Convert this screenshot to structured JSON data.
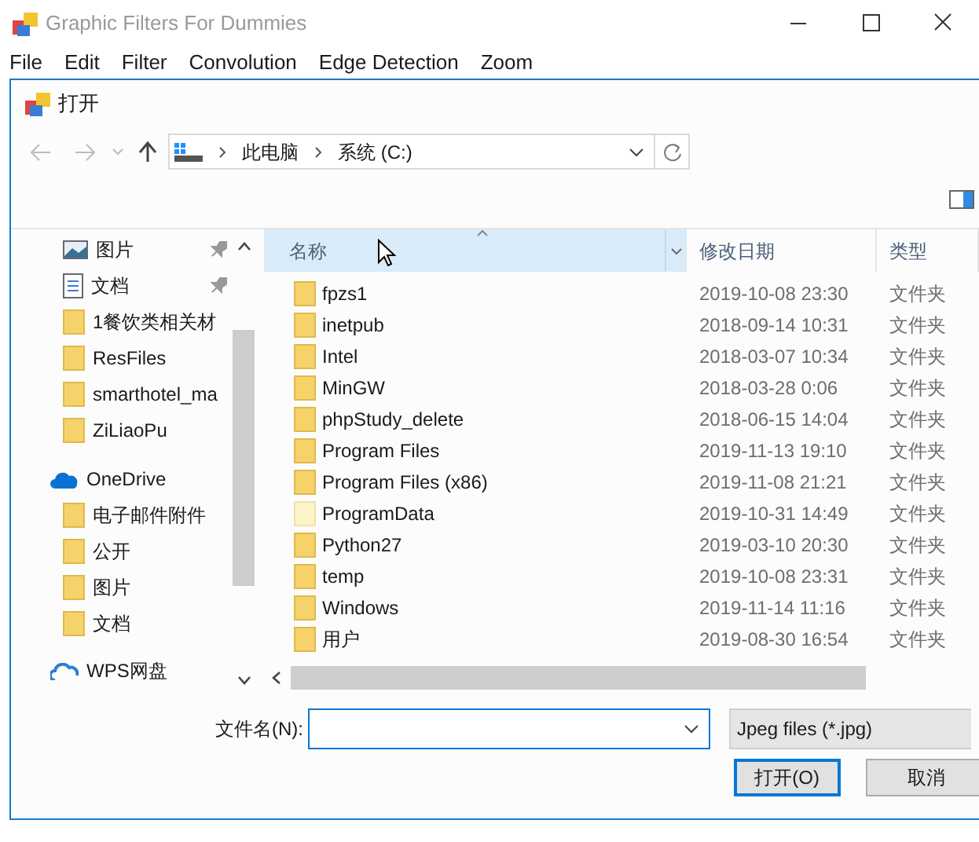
{
  "window": {
    "title": "Graphic Filters For Dummies"
  },
  "menu": [
    "File",
    "Edit",
    "Filter",
    "Convolution",
    "Edge Detection",
    "Zoom"
  ],
  "dialog": {
    "title": "打开",
    "address": {
      "segments": [
        "此电脑",
        "系统 (C:)"
      ]
    },
    "nav_pane": [
      {
        "kind": "pictures",
        "label": "图片",
        "pinned": true
      },
      {
        "kind": "document",
        "label": "文档",
        "pinned": true
      },
      {
        "kind": "folder",
        "label": "1餐饮类相关材",
        "pinned": false
      },
      {
        "kind": "folder",
        "label": "ResFiles",
        "pinned": false
      },
      {
        "kind": "folder",
        "label": "smarthotel_ma",
        "pinned": false
      },
      {
        "kind": "folder",
        "label": "ZiLiaoPu",
        "pinned": false
      },
      {
        "kind": "onedrive",
        "label": "OneDrive",
        "pinned": false
      },
      {
        "kind": "folder",
        "label": "电子邮件附件",
        "pinned": false
      },
      {
        "kind": "folder",
        "label": "公开",
        "pinned": false
      },
      {
        "kind": "folder",
        "label": "图片",
        "pinned": false
      },
      {
        "kind": "folder",
        "label": "文档",
        "pinned": false
      },
      {
        "kind": "wps",
        "label": "WPS网盘",
        "pinned": false
      }
    ],
    "columns": [
      {
        "label": "名称",
        "highlighted": true,
        "sorted": true
      },
      {
        "label": "修改日期",
        "highlighted": false,
        "sorted": false
      },
      {
        "label": "类型",
        "highlighted": false,
        "sorted": false
      }
    ],
    "rows": [
      {
        "name": "fpzs1",
        "date": "2019-10-08 23:30",
        "type": "文件夹",
        "hidden": false
      },
      {
        "name": "inetpub",
        "date": "2018-09-14 10:31",
        "type": "文件夹",
        "hidden": false
      },
      {
        "name": "Intel",
        "date": "2018-03-07 10:34",
        "type": "文件夹",
        "hidden": false
      },
      {
        "name": "MinGW",
        "date": "2018-03-28 0:06",
        "type": "文件夹",
        "hidden": false
      },
      {
        "name": "phpStudy_delete",
        "date": "2018-06-15 14:04",
        "type": "文件夹",
        "hidden": false
      },
      {
        "name": "Program Files",
        "date": "2019-11-13 19:10",
        "type": "文件夹",
        "hidden": false
      },
      {
        "name": "Program Files (x86)",
        "date": "2019-11-08 21:21",
        "type": "文件夹",
        "hidden": false
      },
      {
        "name": "ProgramData",
        "date": "2019-10-31 14:49",
        "type": "文件夹",
        "hidden": true
      },
      {
        "name": "Python27",
        "date": "2019-03-10 20:30",
        "type": "文件夹",
        "hidden": false
      },
      {
        "name": "temp",
        "date": "2019-10-08 23:31",
        "type": "文件夹",
        "hidden": false
      },
      {
        "name": "Windows",
        "date": "2019-11-14 11:16",
        "type": "文件夹",
        "hidden": false
      },
      {
        "name": "用户",
        "date": "2019-08-30 16:54",
        "type": "文件夹",
        "hidden": false
      }
    ],
    "filename_label": "文件名(N):",
    "filter": "Jpeg files (*.jpg)",
    "buttons": [
      {
        "label": "打开(O)",
        "default": true
      },
      {
        "label": "取消",
        "default": false
      }
    ]
  }
}
